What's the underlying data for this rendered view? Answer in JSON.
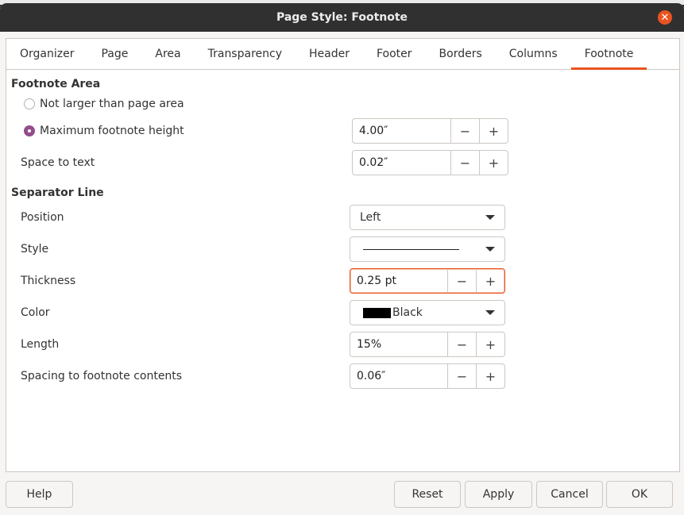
{
  "dialog": {
    "title": "Page Style: Footnote",
    "close_glyph": "✕"
  },
  "tabs": [
    {
      "label": "Organizer"
    },
    {
      "label": "Page"
    },
    {
      "label": "Area"
    },
    {
      "label": "Transparency"
    },
    {
      "label": "Header"
    },
    {
      "label": "Footer"
    },
    {
      "label": "Borders"
    },
    {
      "label": "Columns"
    },
    {
      "label": "Footnote",
      "active": true
    }
  ],
  "footnote_area": {
    "heading": "Footnote Area",
    "option_not_larger": "Not larger than page area",
    "option_max_height": "Maximum footnote height",
    "selected_option": "Maximum footnote height",
    "max_height_value": "4.00″",
    "space_to_text_label": "Space to text",
    "space_to_text_value": "0.02″"
  },
  "separator_line": {
    "heading": "Separator Line",
    "position_label": "Position",
    "position_value": "Left",
    "style_label": "Style",
    "thickness_label": "Thickness",
    "thickness_value": "0.25 pt",
    "color_label": "Color",
    "color_value": "Black",
    "color_hex": "#000000",
    "length_label": "Length",
    "length_value": "15%",
    "spacing_label": "Spacing to footnote contents",
    "spacing_value": "0.06″"
  },
  "spin_glyphs": {
    "minus": "−",
    "plus": "+"
  },
  "buttons": {
    "help": "Help",
    "reset": "Reset",
    "apply": "Apply",
    "cancel": "Cancel",
    "ok": "OK"
  },
  "colors": {
    "accent": "#e95420",
    "radio_checked": "#924d8b",
    "titlebar": "#303030"
  }
}
